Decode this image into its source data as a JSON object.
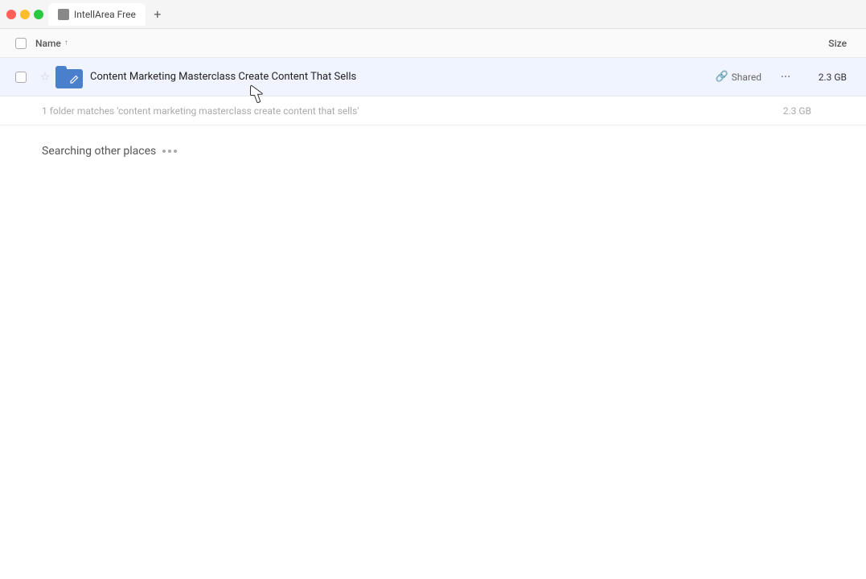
{
  "window": {
    "app_name": "IntellArea Free"
  },
  "title_bar": {
    "tab_label": "IntellArea Free",
    "add_tab_label": "+"
  },
  "list_header": {
    "name_label": "Name",
    "sort_indicator": "↑",
    "size_label": "Size"
  },
  "file_row": {
    "name": "Content Marketing Masterclass Create Content That Sells",
    "shared_label": "Shared",
    "size": "2.3 GB",
    "more_label": "···"
  },
  "summary": {
    "text": "1 folder matches 'content marketing masterclass create content that sells'",
    "size": "2.3 GB"
  },
  "searching": {
    "label": "Searching other places"
  }
}
